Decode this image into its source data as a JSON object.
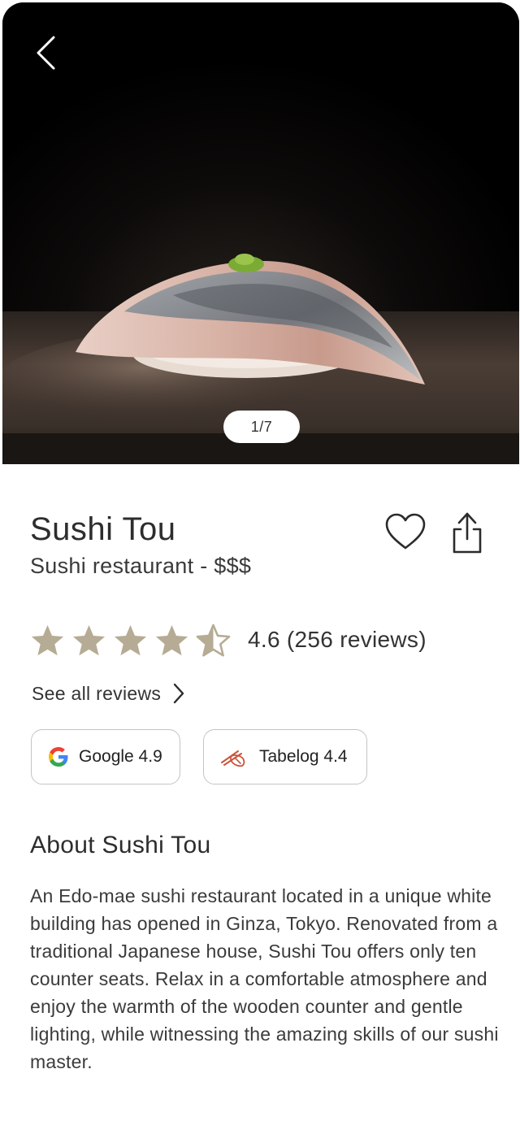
{
  "hero": {
    "image_alt": "Nigiri sushi on a dark counter",
    "counter": "1/7"
  },
  "restaurant": {
    "name": "Sushi Tou",
    "category": "Sushi restaurant - $$$"
  },
  "rating": {
    "value": 4.6,
    "stars_filled": 4.6,
    "stars_total": 5,
    "text": "4.6 (256 reviews)",
    "star_color": "#b6ab94"
  },
  "reviews_link": {
    "label": "See all reviews"
  },
  "sources": [
    {
      "name": "google",
      "label": "Google 4.9"
    },
    {
      "name": "tabelog",
      "label": "Tabelog 4.4"
    }
  ],
  "about": {
    "heading": "About Sushi Tou",
    "body": "An Edo-mae sushi restaurant located in a unique white building has opened in Ginza, Tokyo. Renovated from a traditional Japanese house, Sushi Tou offers only ten counter seats. Relax in a comfortable atmosphere and enjoy the warmth of the wooden counter and gentle lighting, while witnessing the amazing skills of our sushi master."
  },
  "icons": [
    "back-icon",
    "heart-icon",
    "share-icon",
    "star-icon",
    "chevron-right-icon",
    "google-logo-icon",
    "tabelog-logo-icon"
  ]
}
